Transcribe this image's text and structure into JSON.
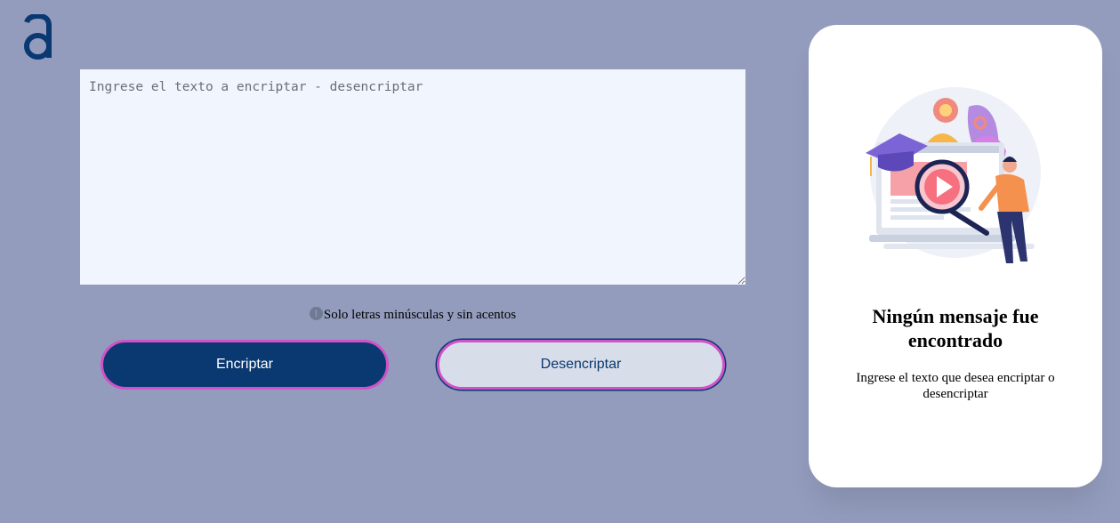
{
  "logo": {
    "icon": "alura-a-logo-icon",
    "color": "#0a3871"
  },
  "input": {
    "placeholder": "Ingrese el texto a encriptar - desencriptar",
    "value": ""
  },
  "hint": {
    "icon": "info-icon",
    "icon_glyph": "!",
    "text": "Solo letras minúsculas y sin acentos"
  },
  "buttons": {
    "encrypt_label": "Encriptar",
    "decrypt_label": "Desencriptar"
  },
  "output_panel": {
    "illustration": "person-with-magnifier-illustration",
    "title": "Ningún mensaje fue encontrado",
    "text": "Ingrese el texto que desea encriptar o desencriptar"
  },
  "colors": {
    "background": "#939cbd",
    "primary": "#0a3871",
    "accent_border": "#d052c8",
    "input_bg": "#f1f5fd",
    "secondary_button_bg": "#d8dee9",
    "panel_bg": "#ffffff"
  }
}
